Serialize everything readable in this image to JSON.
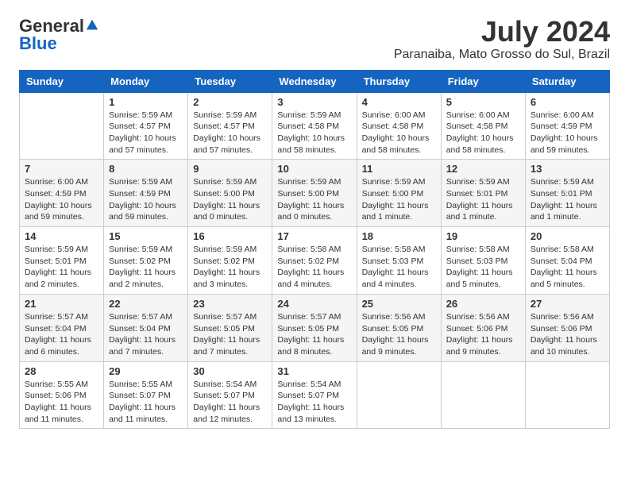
{
  "header": {
    "logo": {
      "general": "General",
      "blue": "Blue"
    },
    "title": "July 2024",
    "location": "Paranaiba, Mato Grosso do Sul, Brazil"
  },
  "weekdays": [
    "Sunday",
    "Monday",
    "Tuesday",
    "Wednesday",
    "Thursday",
    "Friday",
    "Saturday"
  ],
  "weeks": [
    [
      {
        "day": "",
        "info": ""
      },
      {
        "day": "1",
        "info": "Sunrise: 5:59 AM\nSunset: 4:57 PM\nDaylight: 10 hours\nand 57 minutes."
      },
      {
        "day": "2",
        "info": "Sunrise: 5:59 AM\nSunset: 4:57 PM\nDaylight: 10 hours\nand 57 minutes."
      },
      {
        "day": "3",
        "info": "Sunrise: 5:59 AM\nSunset: 4:58 PM\nDaylight: 10 hours\nand 58 minutes."
      },
      {
        "day": "4",
        "info": "Sunrise: 6:00 AM\nSunset: 4:58 PM\nDaylight: 10 hours\nand 58 minutes."
      },
      {
        "day": "5",
        "info": "Sunrise: 6:00 AM\nSunset: 4:58 PM\nDaylight: 10 hours\nand 58 minutes."
      },
      {
        "day": "6",
        "info": "Sunrise: 6:00 AM\nSunset: 4:59 PM\nDaylight: 10 hours\nand 59 minutes."
      }
    ],
    [
      {
        "day": "7",
        "info": "Sunrise: 6:00 AM\nSunset: 4:59 PM\nDaylight: 10 hours\nand 59 minutes."
      },
      {
        "day": "8",
        "info": "Sunrise: 5:59 AM\nSunset: 4:59 PM\nDaylight: 10 hours\nand 59 minutes."
      },
      {
        "day": "9",
        "info": "Sunrise: 5:59 AM\nSunset: 5:00 PM\nDaylight: 11 hours\nand 0 minutes."
      },
      {
        "day": "10",
        "info": "Sunrise: 5:59 AM\nSunset: 5:00 PM\nDaylight: 11 hours\nand 0 minutes."
      },
      {
        "day": "11",
        "info": "Sunrise: 5:59 AM\nSunset: 5:00 PM\nDaylight: 11 hours\nand 1 minute."
      },
      {
        "day": "12",
        "info": "Sunrise: 5:59 AM\nSunset: 5:01 PM\nDaylight: 11 hours\nand 1 minute."
      },
      {
        "day": "13",
        "info": "Sunrise: 5:59 AM\nSunset: 5:01 PM\nDaylight: 11 hours\nand 1 minute."
      }
    ],
    [
      {
        "day": "14",
        "info": "Sunrise: 5:59 AM\nSunset: 5:01 PM\nDaylight: 11 hours\nand 2 minutes."
      },
      {
        "day": "15",
        "info": "Sunrise: 5:59 AM\nSunset: 5:02 PM\nDaylight: 11 hours\nand 2 minutes."
      },
      {
        "day": "16",
        "info": "Sunrise: 5:59 AM\nSunset: 5:02 PM\nDaylight: 11 hours\nand 3 minutes."
      },
      {
        "day": "17",
        "info": "Sunrise: 5:58 AM\nSunset: 5:02 PM\nDaylight: 11 hours\nand 4 minutes."
      },
      {
        "day": "18",
        "info": "Sunrise: 5:58 AM\nSunset: 5:03 PM\nDaylight: 11 hours\nand 4 minutes."
      },
      {
        "day": "19",
        "info": "Sunrise: 5:58 AM\nSunset: 5:03 PM\nDaylight: 11 hours\nand 5 minutes."
      },
      {
        "day": "20",
        "info": "Sunrise: 5:58 AM\nSunset: 5:04 PM\nDaylight: 11 hours\nand 5 minutes."
      }
    ],
    [
      {
        "day": "21",
        "info": "Sunrise: 5:57 AM\nSunset: 5:04 PM\nDaylight: 11 hours\nand 6 minutes."
      },
      {
        "day": "22",
        "info": "Sunrise: 5:57 AM\nSunset: 5:04 PM\nDaylight: 11 hours\nand 7 minutes."
      },
      {
        "day": "23",
        "info": "Sunrise: 5:57 AM\nSunset: 5:05 PM\nDaylight: 11 hours\nand 7 minutes."
      },
      {
        "day": "24",
        "info": "Sunrise: 5:57 AM\nSunset: 5:05 PM\nDaylight: 11 hours\nand 8 minutes."
      },
      {
        "day": "25",
        "info": "Sunrise: 5:56 AM\nSunset: 5:05 PM\nDaylight: 11 hours\nand 9 minutes."
      },
      {
        "day": "26",
        "info": "Sunrise: 5:56 AM\nSunset: 5:06 PM\nDaylight: 11 hours\nand 9 minutes."
      },
      {
        "day": "27",
        "info": "Sunrise: 5:56 AM\nSunset: 5:06 PM\nDaylight: 11 hours\nand 10 minutes."
      }
    ],
    [
      {
        "day": "28",
        "info": "Sunrise: 5:55 AM\nSunset: 5:06 PM\nDaylight: 11 hours\nand 11 minutes."
      },
      {
        "day": "29",
        "info": "Sunrise: 5:55 AM\nSunset: 5:07 PM\nDaylight: 11 hours\nand 11 minutes."
      },
      {
        "day": "30",
        "info": "Sunrise: 5:54 AM\nSunset: 5:07 PM\nDaylight: 11 hours\nand 12 minutes."
      },
      {
        "day": "31",
        "info": "Sunrise: 5:54 AM\nSunset: 5:07 PM\nDaylight: 11 hours\nand 13 minutes."
      },
      {
        "day": "",
        "info": ""
      },
      {
        "day": "",
        "info": ""
      },
      {
        "day": "",
        "info": ""
      }
    ]
  ]
}
